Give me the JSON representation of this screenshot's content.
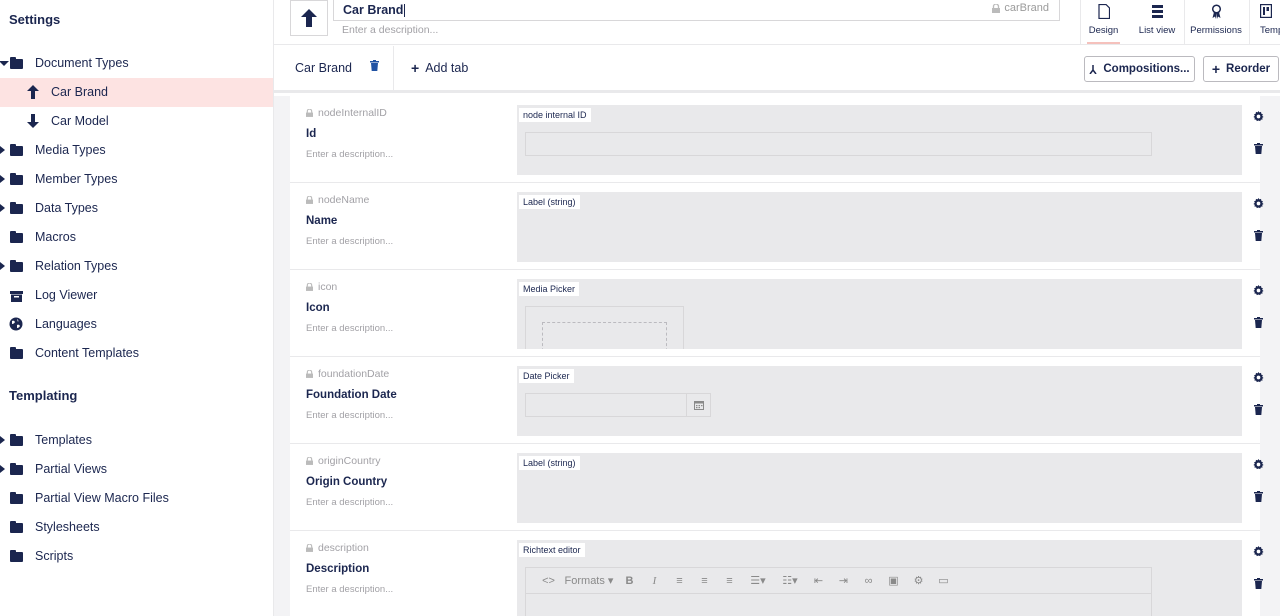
{
  "sidebar": {
    "settings_title": "Settings",
    "templating_title": "Templating",
    "items": [
      {
        "label": "Document Types"
      },
      {
        "label": "Car Brand"
      },
      {
        "label": "Car Model"
      },
      {
        "label": "Media Types"
      },
      {
        "label": "Member Types"
      },
      {
        "label": "Data Types"
      },
      {
        "label": "Macros"
      },
      {
        "label": "Relation Types"
      },
      {
        "label": "Log Viewer"
      },
      {
        "label": "Languages"
      },
      {
        "label": "Content Templates"
      }
    ],
    "templating_items": [
      {
        "label": "Templates"
      },
      {
        "label": "Partial Views"
      },
      {
        "label": "Partial View Macro Files"
      },
      {
        "label": "Stylesheets"
      },
      {
        "label": "Scripts"
      }
    ]
  },
  "header": {
    "name_value": "Car Brand",
    "alias": "carBrand",
    "description_placeholder": "Enter a description...",
    "views": [
      {
        "label": "Design",
        "icon": "document-icon"
      },
      {
        "label": "List view",
        "icon": "list-icon"
      },
      {
        "label": "Permissions",
        "icon": "ribbon-icon"
      },
      {
        "label": "Temp",
        "icon": "template-icon"
      }
    ]
  },
  "tabs": {
    "current": "Car Brand",
    "add_label": "Add tab",
    "compositions_label": "Compositions...",
    "reorder_label": "Reorder"
  },
  "properties": [
    {
      "alias": "nodeInternalID",
      "name": "Id",
      "description": "Enter a description...",
      "editor": "node internal ID"
    },
    {
      "alias": "nodeName",
      "name": "Name",
      "description": "Enter a description...",
      "editor": "Label (string)"
    },
    {
      "alias": "icon",
      "name": "Icon",
      "description": "Enter a description...",
      "editor": "Media Picker"
    },
    {
      "alias": "foundationDate",
      "name": "Foundation Date",
      "description": "Enter a description...",
      "editor": "Date Picker"
    },
    {
      "alias": "originCountry",
      "name": "Origin Country",
      "description": "Enter a description...",
      "editor": "Label (string)"
    },
    {
      "alias": "description",
      "name": "Description",
      "description": "Enter a description...",
      "editor": "Richtext editor"
    }
  ],
  "rte": {
    "formats_label": "Formats"
  },
  "colors": {
    "navy": "#1b264f",
    "active_bg": "#fde3e2",
    "editor_bg": "#e9e9eb",
    "accent": "#f5c1bc"
  }
}
